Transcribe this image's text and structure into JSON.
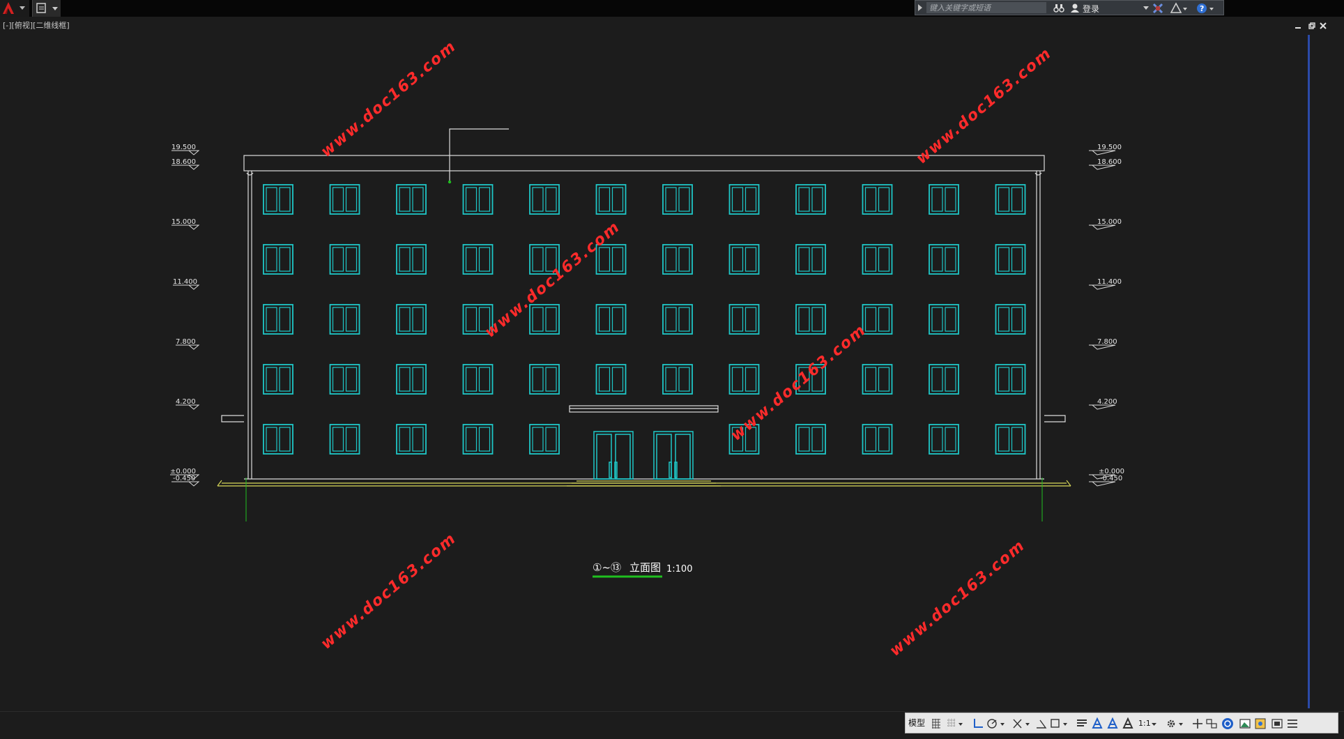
{
  "topbar": {
    "search_placeholder": "键入关键字或短语",
    "login_label": "登录"
  },
  "viewport": {
    "label": "[-][俯视][二维线框]"
  },
  "drawing": {
    "elevation_labels": [
      "19.500",
      "18.600",
      "15.000",
      "11.400",
      "7.800",
      "4.200",
      "±0.000",
      "-0.450"
    ],
    "title_prefix": "①~⑬",
    "title": "立面图",
    "scale": "1:100",
    "watermark": "www.doc163.com",
    "line_color": "#dcdcdc",
    "window_color": "#1ec8c8",
    "ground_color": "#d8d858",
    "axis_color": "#1fbf1f",
    "watermark_color": "#ff2b2b",
    "windows": {
      "columns": 12,
      "rows": 5
    }
  },
  "statusbar": {
    "model_label": "模型",
    "annotation_scale": "1:1"
  }
}
